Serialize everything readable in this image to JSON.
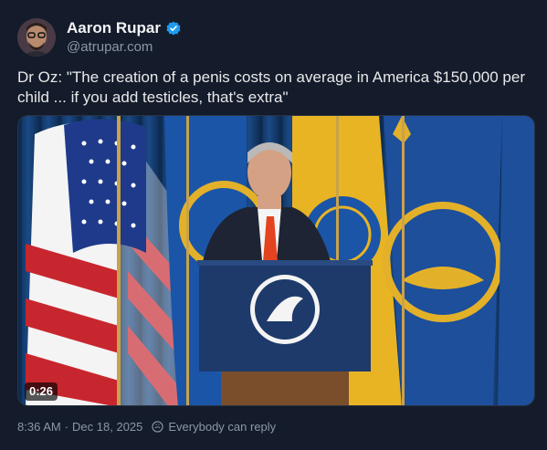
{
  "author": {
    "name": "Aaron Rupar",
    "handle": "@atrupar.com",
    "verified_color": "#1d9bf0"
  },
  "post": {
    "text": "Dr Oz: \"The creation of a penis costs on average in America $150,000 per child ... if you add testicles, that's extra\""
  },
  "media": {
    "duration": "0:26"
  },
  "footer": {
    "timestamp": "8:36 AM",
    "separator": "·",
    "date": "Dec 18, 2025",
    "reply_setting": "Everybody can reply"
  },
  "colors": {
    "background": "#141b2a",
    "text": "#e7e9ea",
    "muted": "#8b98a5"
  }
}
